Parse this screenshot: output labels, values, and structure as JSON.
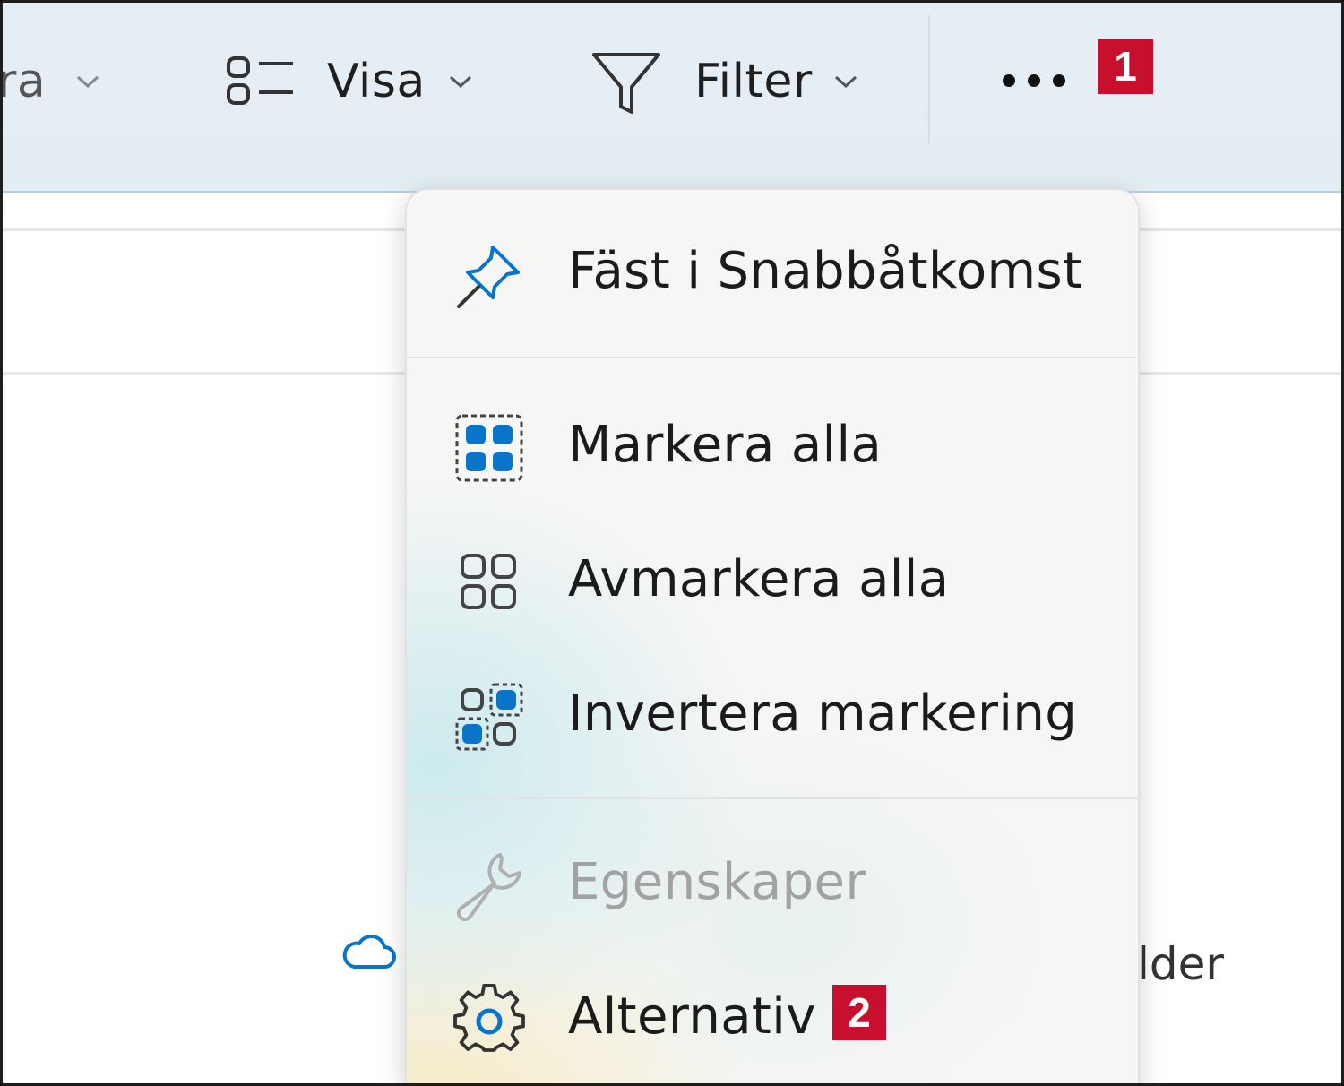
{
  "toolbar": {
    "sort_label_partial": "ra",
    "view_label": "Visa",
    "filter_label": "Filter",
    "badge_1": "1"
  },
  "menu": {
    "items": [
      {
        "label": "Fäst i Snabbåtkomst",
        "icon": "pin-icon",
        "enabled": true
      },
      {
        "label": "Markera alla",
        "icon": "select-all-icon",
        "enabled": true
      },
      {
        "label": "Avmarkera alla",
        "icon": "select-none-icon",
        "enabled": true
      },
      {
        "label": "Invertera markering",
        "icon": "invert-selection-icon",
        "enabled": true
      },
      {
        "label": "Egenskaper",
        "icon": "wrench-icon",
        "enabled": false
      },
      {
        "label": "Alternativ",
        "icon": "gear-icon",
        "enabled": true
      }
    ],
    "badge_2": "2"
  },
  "background": {
    "partial_text": "lder"
  },
  "colors": {
    "accent_blue": "#0067c0",
    "badge_red": "#c8102e",
    "toolbar_bg": "#e4edf4"
  }
}
